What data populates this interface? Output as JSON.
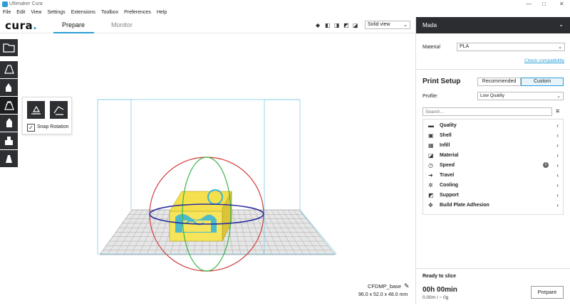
{
  "window": {
    "title": "Ultimaker Cura",
    "controls": [
      "—",
      "□",
      "✕"
    ]
  },
  "menu": [
    "File",
    "Edit",
    "View",
    "Settings",
    "Extensions",
    "Toolbox",
    "Preferences",
    "Help"
  ],
  "header": {
    "logo_text": "cura",
    "tabs": [
      {
        "label": "Prepare",
        "active": true
      },
      {
        "label": "Monitor",
        "active": false
      }
    ],
    "view_mode": "Solid view"
  },
  "left_toolbar": {
    "tools": [
      "open-file",
      "move",
      "scale",
      "rotate",
      "mirror",
      "per-model-settings",
      "support-blocker"
    ],
    "active_tool": "rotate",
    "rotate_popup": {
      "buttons": [
        "lay-flat",
        "select-face-to-align"
      ],
      "snap_rotation_label": "Snap Rotation",
      "snap_rotation_checked": true
    }
  },
  "viewport": {
    "model_name": "CFDMP_base",
    "model_dimensions": "96.0 x 52.0 x 48.0 mm"
  },
  "right_panel": {
    "machine_name": "Mada",
    "material_label": "Material",
    "material_value": "PLA",
    "check_compatibility": "Check compatibility",
    "print_setup_title": "Print Setup",
    "mode_buttons": {
      "recommended": "Recommended",
      "custom": "Custom"
    },
    "active_mode": "Custom",
    "profile_label": "Profile:",
    "profile_value": "Low Quality",
    "search_placeholder": "Search...",
    "settings_categories": [
      {
        "label": "Quality",
        "icon": "quality-icon",
        "info": false
      },
      {
        "label": "Shell",
        "icon": "shell-icon",
        "info": false
      },
      {
        "label": "Infill",
        "icon": "infill-icon",
        "info": false
      },
      {
        "label": "Material",
        "icon": "material-icon",
        "info": false
      },
      {
        "label": "Speed",
        "icon": "speed-icon",
        "info": true
      },
      {
        "label": "Travel",
        "icon": "travel-icon",
        "info": false
      },
      {
        "label": "Cooling",
        "icon": "cooling-icon",
        "info": false
      },
      {
        "label": "Support",
        "icon": "support-icon",
        "info": false
      },
      {
        "label": "Build Plate Adhesion",
        "icon": "build-plate-adhesion-icon",
        "info": false
      }
    ],
    "ready_label": "Ready to slice",
    "print_time": "00h 00min",
    "print_stats": "0.00m / ~ 0g",
    "prepare_button": "Prepare"
  },
  "colors": {
    "accent": "#2a9fd6",
    "toolbar_dark": "#2d2f32",
    "machine_bar": "#2b2d30",
    "model_yellow": "#f4e04d",
    "model_cyan": "#3bb5d6",
    "rot_red": "#d23b3b",
    "rot_green": "#3cb34a",
    "rot_blue": "#2b2f9e"
  }
}
